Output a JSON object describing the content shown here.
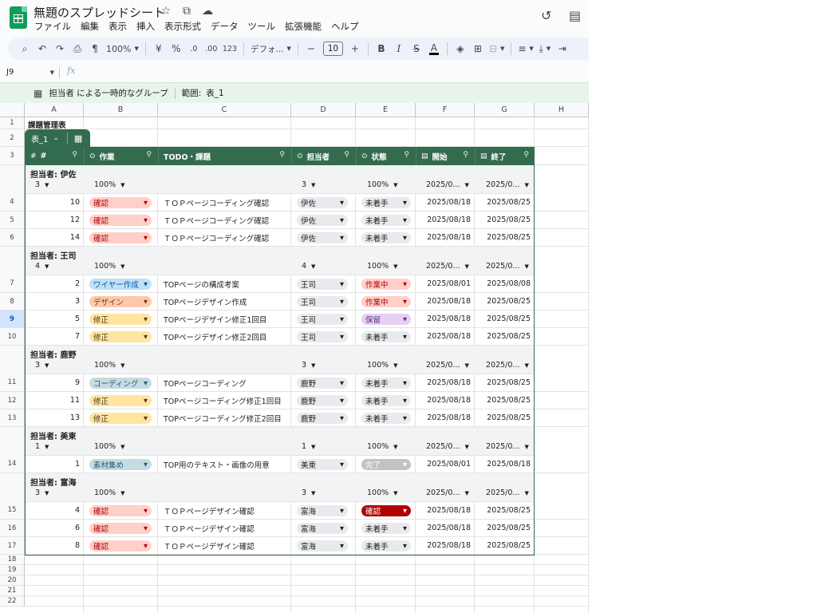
{
  "app": {
    "doc_title": "無題のスプレッドシート",
    "menu": [
      "ファイル",
      "編集",
      "表示",
      "挿入",
      "表示形式",
      "データ",
      "ツール",
      "拡張機能",
      "ヘルプ"
    ]
  },
  "toolbar": {
    "zoom": "100%",
    "currency": "¥",
    "percent": "%",
    "dec_decrease": ".0",
    "dec_increase": ".00",
    "number_format": "123",
    "font": "デフォ...",
    "font_size": "10",
    "bold": "B",
    "italic": "I",
    "text_color": "A"
  },
  "formula_bar": {
    "cell_ref": "J9",
    "fx": "fx"
  },
  "group_banner": {
    "text": "担当者 による一時的なグループ",
    "range_label": "範囲:",
    "range_value": "表_1"
  },
  "columns": [
    "A",
    "B",
    "C",
    "D",
    "E",
    "F",
    "G",
    "H"
  ],
  "row_numbers": [
    "1",
    "2",
    "3",
    "4",
    "5",
    "6",
    "7",
    "8",
    "9",
    "10",
    "11",
    "12",
    "13",
    "14",
    "15",
    "16",
    "17",
    "18",
    "19",
    "20",
    "21",
    "22"
  ],
  "sheet_title": "課題管理表",
  "table": {
    "name": "表_1",
    "headers": {
      "id": "#",
      "task": "作業",
      "todo": "TODO・課題",
      "owner": "担当者",
      "status": "状態",
      "start": "開始",
      "end": "終了"
    },
    "groups": [
      {
        "label": "担当者: 伊佐",
        "agg": {
          "count": "3",
          "task_pct": "100%",
          "owner_count": "3",
          "status_pct": "100%",
          "start": "2025/0...",
          "end": "2025/0..."
        },
        "rows": [
          {
            "id": "10",
            "task": "確認",
            "todo": "ＴＯＰページコーディング確認",
            "owner": "伊佐",
            "status": "未着手",
            "start": "2025/08/18",
            "end": "2025/08/25"
          },
          {
            "id": "12",
            "task": "確認",
            "todo": "ＴＯＰページコーディング確認",
            "owner": "伊佐",
            "status": "未着手",
            "start": "2025/08/18",
            "end": "2025/08/25"
          },
          {
            "id": "14",
            "task": "確認",
            "todo": "ＴＯＰページコーディング確認",
            "owner": "伊佐",
            "status": "未着手",
            "start": "2025/08/18",
            "end": "2025/08/25"
          }
        ]
      },
      {
        "label": "担当者: 王司",
        "agg": {
          "count": "4",
          "task_pct": "100%",
          "owner_count": "4",
          "status_pct": "100%",
          "start": "2025/0...",
          "end": "2025/0..."
        },
        "rows": [
          {
            "id": "2",
            "task": "ワイヤー作成",
            "todo": "TOPページの構成考案",
            "owner": "王司",
            "status": "作業中",
            "start": "2025/08/01",
            "end": "2025/08/08"
          },
          {
            "id": "3",
            "task": "デザイン",
            "todo": "TOPページデザイン作成",
            "owner": "王司",
            "status": "作業中",
            "start": "2025/08/18",
            "end": "2025/08/25"
          },
          {
            "id": "5",
            "task": "修正",
            "todo": "TOPページデザイン修正1回目",
            "owner": "王司",
            "status": "保留",
            "start": "2025/08/18",
            "end": "2025/08/25"
          },
          {
            "id": "7",
            "task": "修正",
            "todo": "TOPページデザイン修正2回目",
            "owner": "王司",
            "status": "未着手",
            "start": "2025/08/18",
            "end": "2025/08/25"
          }
        ]
      },
      {
        "label": "担当者: 鹿野",
        "agg": {
          "count": "3",
          "task_pct": "100%",
          "owner_count": "3",
          "status_pct": "100%",
          "start": "2025/0...",
          "end": "2025/0..."
        },
        "rows": [
          {
            "id": "9",
            "task": "コーディング",
            "todo": "TOPページコーディング",
            "owner": "鹿野",
            "status": "未着手",
            "start": "2025/08/18",
            "end": "2025/08/25"
          },
          {
            "id": "11",
            "task": "修正",
            "todo": "TOPページコーディング修正1回目",
            "owner": "鹿野",
            "status": "未着手",
            "start": "2025/08/18",
            "end": "2025/08/25"
          },
          {
            "id": "13",
            "task": "修正",
            "todo": "TOPページコーディング修正2回目",
            "owner": "鹿野",
            "status": "未着手",
            "start": "2025/08/18",
            "end": "2025/08/25"
          }
        ]
      },
      {
        "label": "担当者: 美東",
        "agg": {
          "count": "1",
          "task_pct": "100%",
          "owner_count": "1",
          "status_pct": "100%",
          "start": "2025/0...",
          "end": "2025/0..."
        },
        "rows": [
          {
            "id": "1",
            "task": "素材集め",
            "todo": "TOP用のテキスト・画像の用意",
            "owner": "美東",
            "status": "完了",
            "start": "2025/08/01",
            "end": "2025/08/18"
          }
        ]
      },
      {
        "label": "担当者: 富海",
        "agg": {
          "count": "3",
          "task_pct": "100%",
          "owner_count": "3",
          "status_pct": "100%",
          "start": "2025/0...",
          "end": "2025/0..."
        },
        "rows": [
          {
            "id": "4",
            "task": "確認",
            "todo": "ＴＯＰページデザイン確認",
            "owner": "富海",
            "status": "確認",
            "start": "2025/08/18",
            "end": "2025/08/25"
          },
          {
            "id": "6",
            "task": "確認",
            "todo": "ＴＯＰページデザイン確認",
            "owner": "富海",
            "status": "未着手",
            "start": "2025/08/18",
            "end": "2025/08/25"
          },
          {
            "id": "8",
            "task": "確認",
            "todo": "ＴＯＰページデザイン確認",
            "owner": "富海",
            "status": "未着手",
            "start": "2025/08/18",
            "end": "2025/08/25"
          }
        ]
      }
    ]
  },
  "chip_colors": {
    "task": {
      "確認": "c-red",
      "ワイヤー作成": "c-blue",
      "デザイン": "c-orange",
      "修正": "c-yellow",
      "コーディング": "c-teal",
      "素材集め": "c-teal"
    },
    "status": {
      "未着手": "c-gray",
      "作業中": "c-red",
      "保留": "c-purple",
      "完了": "c-done",
      "確認": "c-darkred"
    }
  }
}
